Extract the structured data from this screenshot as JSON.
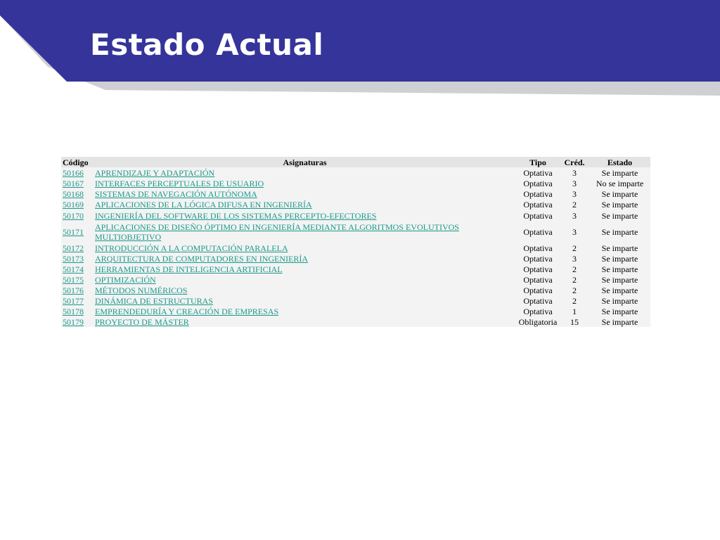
{
  "slide": {
    "title": "Estado Actual",
    "colors": {
      "header_blue": "#35349a",
      "header_gray": "#cfd0d3",
      "link": "#1a9a8a",
      "row_bg": "#f3f3f3",
      "head_bg": "#e4e4e4"
    }
  },
  "table": {
    "headers": {
      "codigo": "Código",
      "asignaturas": "Asignaturas",
      "tipo": "Tipo",
      "cred": "Créd.",
      "estado": "Estado"
    },
    "rows": [
      {
        "code": " 50166",
        "name": " APRENDIZAJE Y ADAPTACIÓN",
        "tipo": "Optativa",
        "cred": "3",
        "estado": "Se imparte"
      },
      {
        "code": " 50167",
        "name": " INTERFACES PERCEPTUALES DE USUARIO",
        "tipo": "Optativa",
        "cred": "3",
        "estado": "No se imparte"
      },
      {
        "code": " 50168",
        "name": " SISTEMAS DE NAVEGACIÓN AUTÓNOMA",
        "tipo": "Optativa",
        "cred": "3",
        "estado": "Se imparte"
      },
      {
        "code": " 50169",
        "name": " APLICACIONES DE LA LÓGICA DIFUSA EN INGENIERÍA",
        "tipo": "Optativa",
        "cred": "2",
        "estado": "Se imparte"
      },
      {
        "code": " 50170",
        "name": " INGENIERÍA DEL SOFTWARE DE LOS SISTEMAS PERCEPTO-EFECTORES",
        "tipo": "Optativa",
        "cred": "3",
        "estado": "Se imparte"
      },
      {
        "code": " 50171",
        "name": " APLICACIONES DE DISEÑO ÓPTIMO EN INGENIERÍA MEDIANTE ALGORITMOS EVOLUTIVOS MULTIOBJETIVO",
        "tipo": "Optativa",
        "cred": "3",
        "estado": "Se imparte"
      },
      {
        "code": " 50172",
        "name": " INTRODUCCIÓN A LA COMPUTACIÓN PARALELA",
        "tipo": "Optativa",
        "cred": "2",
        "estado": "Se imparte"
      },
      {
        "code": " 50173",
        "name": " ARQUITECTURA DE COMPUTADORES EN INGENIERÍA",
        "tipo": "Optativa",
        "cred": "3",
        "estado": "Se imparte"
      },
      {
        "code": " 50174",
        "name": " HERRAMIENTAS DE INTELIGENCIA ARTIFICIAL",
        "tipo": "Optativa",
        "cred": "2",
        "estado": "Se imparte"
      },
      {
        "code": " 50175",
        "name": " OPTIMIZACIÓN",
        "tipo": "Optativa",
        "cred": "2",
        "estado": "Se imparte"
      },
      {
        "code": " 50176",
        "name": " MÉTODOS NUMÉRICOS",
        "tipo": "Optativa",
        "cred": "2",
        "estado": "Se imparte"
      },
      {
        "code": " 50177",
        "name": " DINÁMICA DE ESTRUCTURAS",
        "tipo": "Optativa",
        "cred": "2",
        "estado": "Se imparte"
      },
      {
        "code": " 50178",
        "name": " EMPRENDEDURÍA Y CREACIÓN DE EMPRESAS",
        "tipo": "Optativa",
        "cred": "1",
        "estado": "Se imparte"
      },
      {
        "code": " 50179",
        "name": " PROYECTO DE MÁSTER",
        "tipo": "Obligatoria",
        "cred": "15",
        "estado": "Se imparte"
      }
    ]
  }
}
